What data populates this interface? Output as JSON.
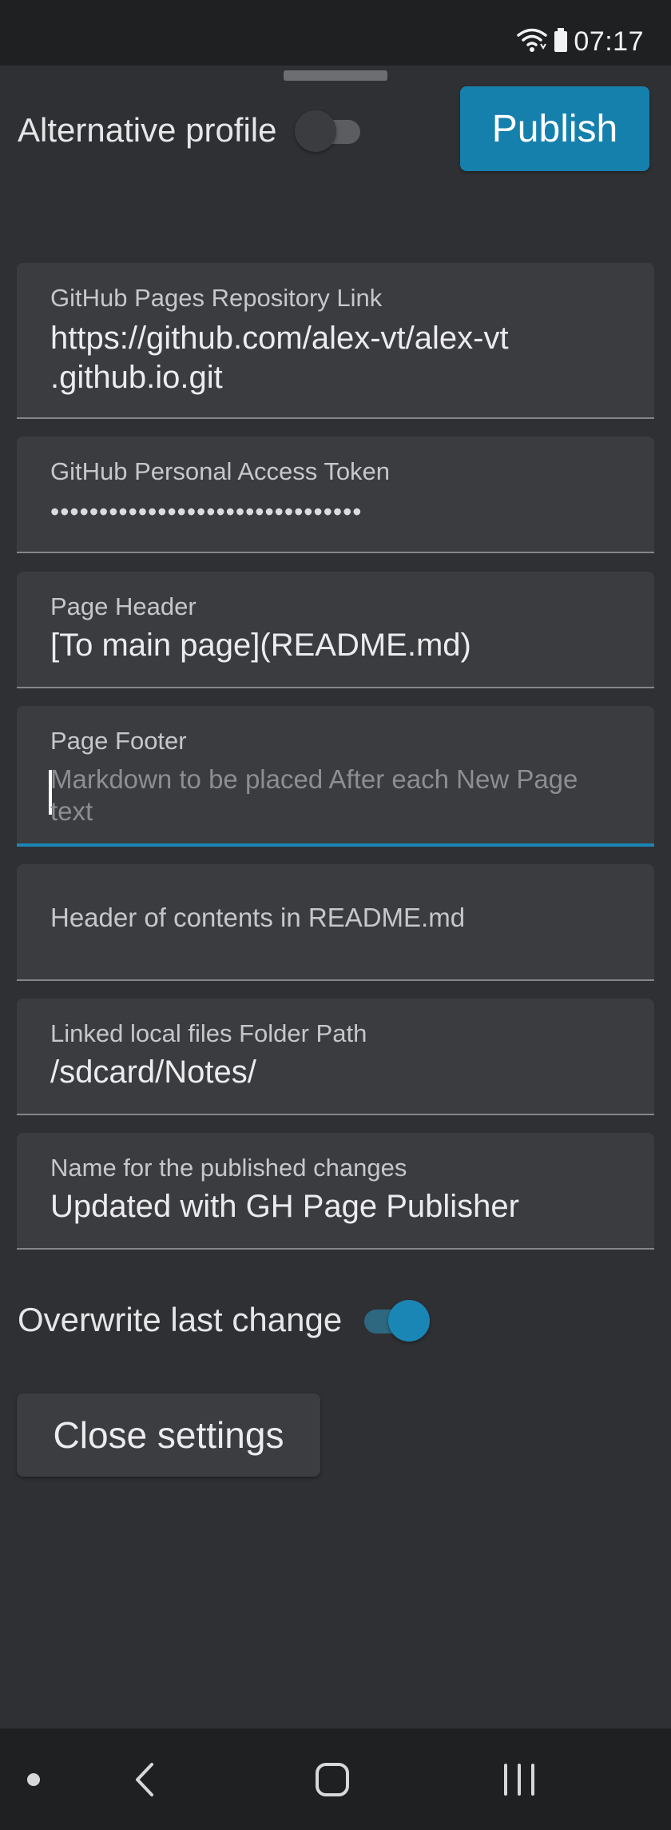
{
  "status_bar": {
    "time": "07:17",
    "icons": [
      "wifi-icon",
      "battery-icon"
    ]
  },
  "top": {
    "alternative_profile_label": "Alternative profile",
    "alternative_profile_on": false,
    "publish_label": "Publish"
  },
  "fields": {
    "repo_link": {
      "label": "GitHub Pages Repository Link",
      "value_line1": "https://github.com/alex-vt/alex-vt",
      "value_line2": ".github.io.git"
    },
    "token": {
      "label": "GitHub Personal Access Token",
      "value": "••••••••••••••••••••••••••••••••"
    },
    "page_header": {
      "label": "Page Header",
      "value": "[To main page](README.md)"
    },
    "page_footer": {
      "label": "Page Footer",
      "placeholder_line1": "Markdown to be placed After each New Page",
      "placeholder_line2": "text"
    },
    "contents_header": {
      "placeholder": "Header of contents in README.md"
    },
    "local_folder": {
      "label": "Linked local files Folder Path",
      "value": "/sdcard/Notes/"
    },
    "commit_name": {
      "label": "Name for the published changes",
      "value": "Updated with GH Page Publisher"
    }
  },
  "overwrite": {
    "label": "Overwrite last change",
    "on": true
  },
  "close_settings_label": "Close settings",
  "nav": {
    "icons": [
      "dot-icon",
      "back-icon",
      "home-icon",
      "recents-icon"
    ]
  },
  "colors": {
    "background": "#2f3033",
    "field_background": "#3b3c40",
    "accent": "#1680ad",
    "bars": "#1f2022"
  }
}
